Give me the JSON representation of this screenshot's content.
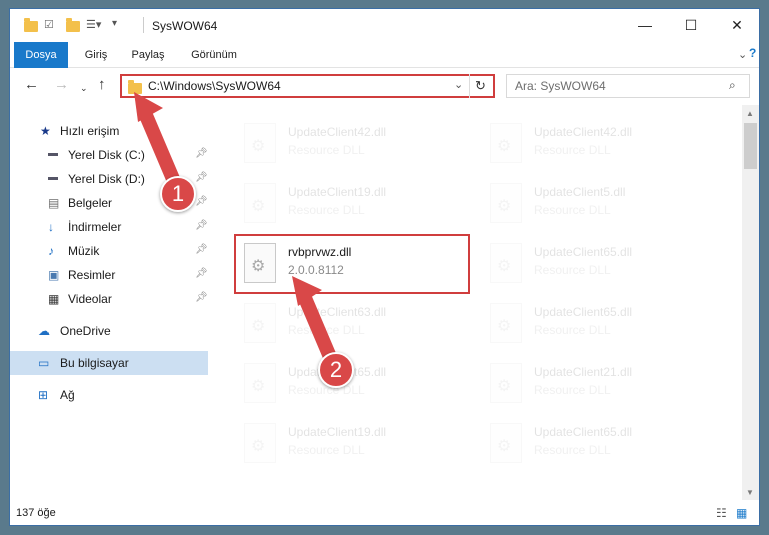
{
  "window": {
    "title": "SysWOW64"
  },
  "ribbon": {
    "tabs": [
      "Dosya",
      "Giriş",
      "Paylaş",
      "Görünüm"
    ]
  },
  "address": {
    "path": "C:\\Windows\\SysWOW64"
  },
  "search": {
    "placeholder": "Ara: SysWOW64"
  },
  "sidebar": {
    "quick_access": "Hızlı erişim",
    "items": [
      "Yerel Disk (C:)",
      "Yerel Disk (D:)",
      "Belgeler",
      "İndirmeler",
      "Müzik",
      "Resimler",
      "Videolar"
    ],
    "onedrive": "OneDrive",
    "this_pc": "Bu bilgisayar",
    "network": "Ağ"
  },
  "files": [
    {
      "name": "UpdateClient42.dll",
      "type": "Resource DLL"
    },
    {
      "name": "UpdateClient42.dll",
      "type": "Resource DLL"
    },
    {
      "name": "UpdateClient19.dll",
      "type": "Resource DLL"
    },
    {
      "name": "UpdateClient5.dll",
      "type": "Resource DLL"
    },
    {
      "name": "rvbprvwz.dll",
      "type": "2.0.0.8112"
    },
    {
      "name": "UpdateClient65.dll",
      "type": "Resource DLL"
    },
    {
      "name": "UpdateClient63.dll",
      "type": "Resource DLL"
    },
    {
      "name": "UpdateClient65.dll",
      "type": "Resource DLL"
    },
    {
      "name": "UpdateClient65.dll",
      "type": "Resource DLL"
    },
    {
      "name": "UpdateClient21.dll",
      "type": "Resource DLL"
    },
    {
      "name": "UpdateClient19.dll",
      "type": "Resource DLL"
    },
    {
      "name": "UpdateClient65.dll",
      "type": "Resource DLL"
    }
  ],
  "status": {
    "count": "137 öğe"
  },
  "callouts": [
    "1",
    "2"
  ],
  "colors": {
    "accent": "#1979ca",
    "highlight": "#d03d3d",
    "callout": "#d94848"
  }
}
